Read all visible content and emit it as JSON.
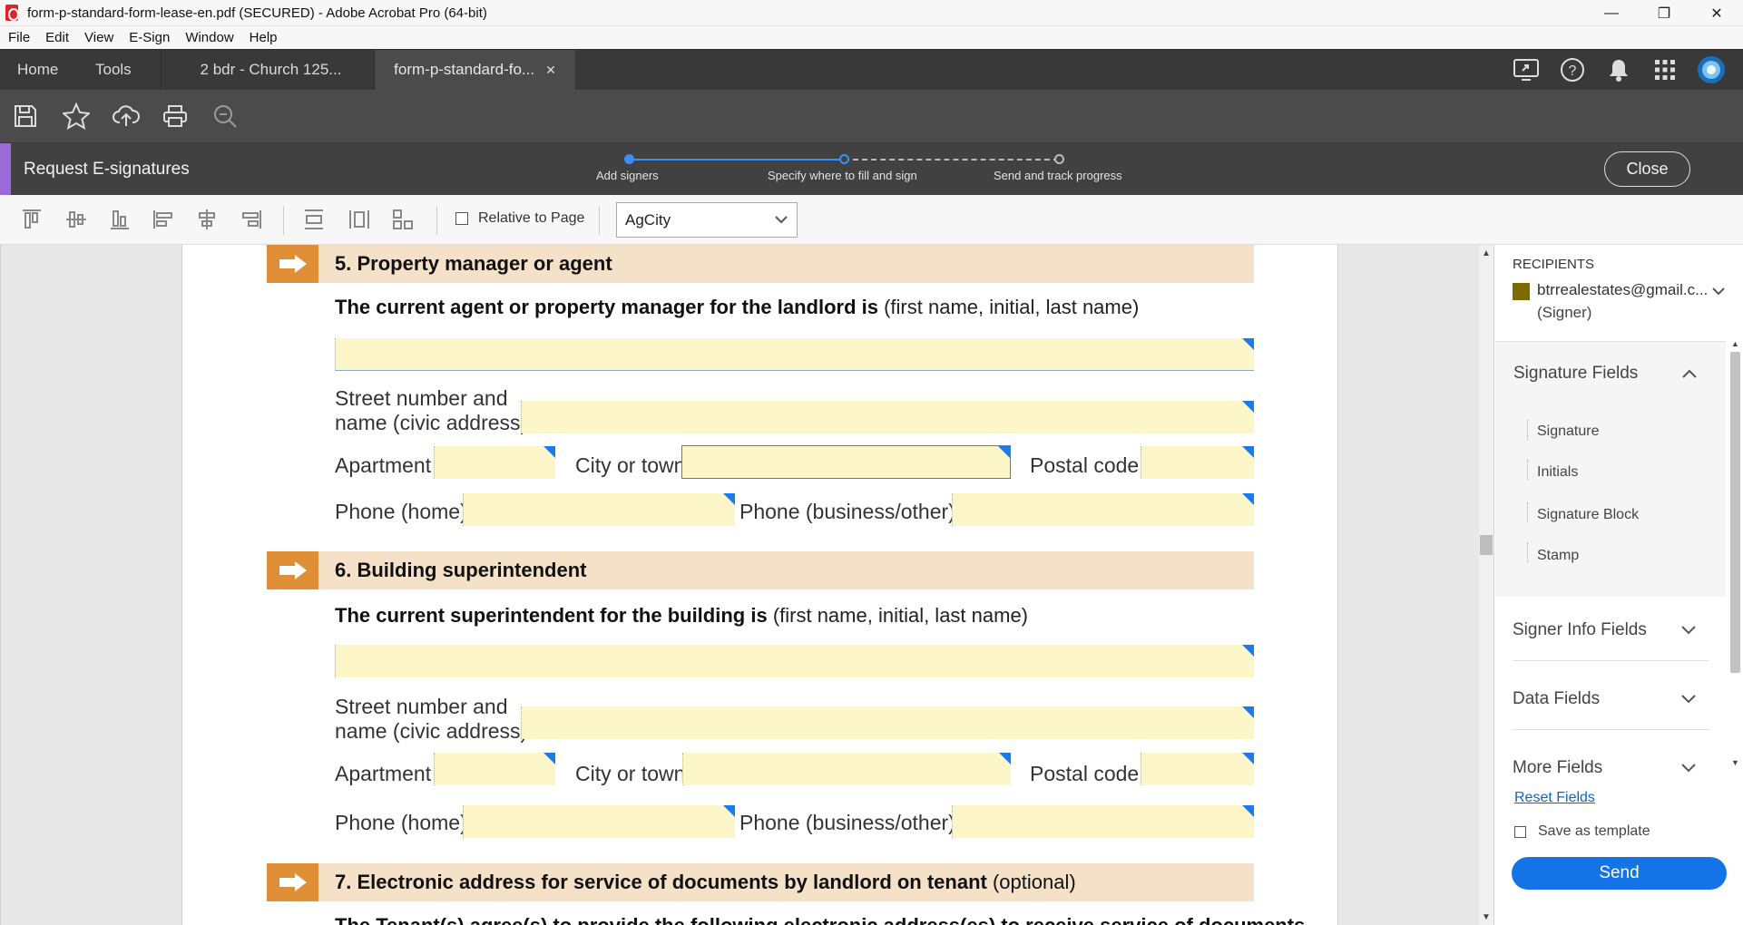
{
  "window": {
    "title": "form-p-standard-form-lease-en.pdf (SECURED) - Adobe Acrobat Pro (64-bit)",
    "controls": {
      "minimize": "—",
      "restore": "❐",
      "close": "✕"
    }
  },
  "menu": [
    "File",
    "Edit",
    "View",
    "E-Sign",
    "Window",
    "Help"
  ],
  "tabs": {
    "home": "Home",
    "tools": "Tools",
    "doc1": "2 bdr - Church 125...",
    "doc2": "form-p-standard-fo...",
    "doc2_close": "✕"
  },
  "esign": {
    "title": "Request E-signatures",
    "steps": [
      "Add signers",
      "Specify where to fill and sign",
      "Send and track progress"
    ],
    "close_label": "Close",
    "accent_color": "#9a6bd8",
    "step_color": "#3d8ef5"
  },
  "align_toolbar": {
    "relative_label": "Relative to Page",
    "field_select": "AgCity"
  },
  "document": {
    "s5_num": "5.",
    "s5_title": "Property manager or agent",
    "s5_intro_bold": "The current agent or property manager for the landlord is",
    "s5_intro_norm": "(first name, initial, last name)",
    "street_label_1": "Street number and",
    "street_label_2": "name (civic address)",
    "apartment": "Apartment",
    "city": "City or town",
    "postal": "Postal code",
    "phone_home": "Phone (home)",
    "phone_business": "Phone (business/other)",
    "s6_num": "6.",
    "s6_title": "Building superintendent",
    "s6_intro_bold": "The current superintendent for the building is",
    "s6_intro_norm": "(first name, initial, last name)",
    "s7_num": "7.",
    "s7_title": "Electronic address for service of documents by landlord on tenant",
    "s7_optional": "(optional)",
    "s7_cut": "The Tenant(s) agree(s) to provide the following electronic address(es) to receive service of documents",
    "header_color": "#f5e0c8",
    "arrow_color": "#e08f36",
    "field_color": "#fdf6c8"
  },
  "panel": {
    "recipients_header": "RECIPIENTS",
    "recipient_email": "btrrealestates@gmail.c...",
    "recipient_role": "(Signer)",
    "recipient_color": "#7a6a00",
    "signature_fields": "Signature Fields",
    "sig_items": [
      "Signature",
      "Initials",
      "Signature Block",
      "Stamp"
    ],
    "signer_info": "Signer Info Fields",
    "data_fields": "Data Fields",
    "more_fields": "More Fields",
    "reset": "Reset Fields",
    "save_template": "Save as template",
    "send": "Send",
    "send_color": "#1473e6"
  }
}
